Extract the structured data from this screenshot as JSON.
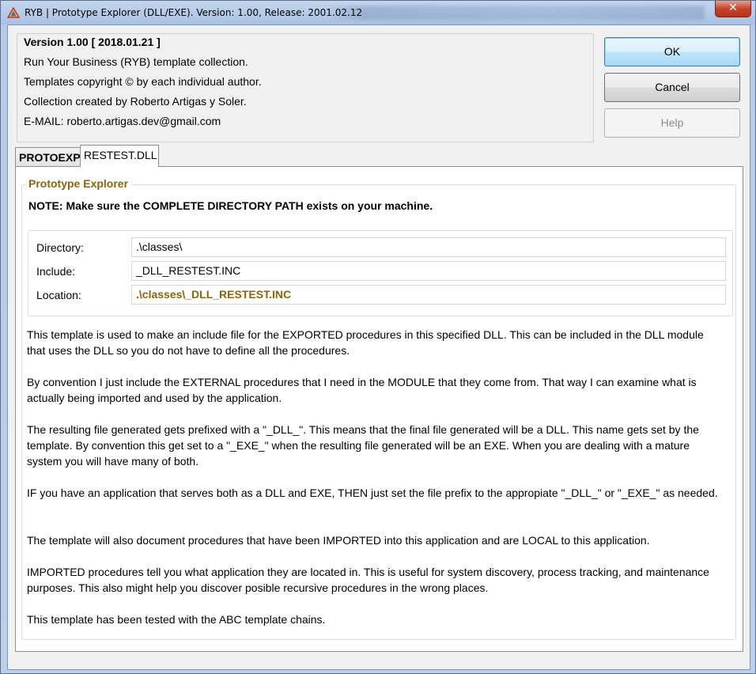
{
  "window": {
    "title": "RYB | Prototype Explorer (DLL/EXE). Version: 1.00, Release: 2001.02.12",
    "close_glyph": "✕"
  },
  "info": {
    "version": "Version 1.00 [ 2018.01.21 ]",
    "line1": "Run Your Business (RYB) template collection.",
    "line2": "Templates copyright © by each individual author.",
    "line3": "Collection created by Roberto Artigas y Soler.",
    "line4": "E-MAIL: roberto.artigas.dev@gmail.com"
  },
  "buttons": {
    "ok": "OK",
    "cancel": "Cancel",
    "help": "Help"
  },
  "tabs": [
    {
      "label": "PROTOEXP",
      "active": false
    },
    {
      "label": "RESTEST.DLL",
      "active": true
    }
  ],
  "panel": {
    "group_title": "Prototype Explorer",
    "note": "NOTE: Make sure the COMPLETE DIRECTORY PATH exists on your machine.",
    "fields": {
      "directory_label": "Directory:",
      "directory_value": ".\\classes\\",
      "include_label": "Include:",
      "include_value": "_DLL_RESTEST.INC",
      "location_label": "Location:",
      "location_value": ".\\classes\\_DLL_RESTEST.INC"
    },
    "paragraphs": [
      "This template is used to make an include file for the EXPORTED procedures in this specified DLL. This can be included in the DLL module that uses the DLL so you do not have to define all the procedures.",
      "By convention I just include the EXTERNAL procedures that I need in the MODULE that they come from. That way I can examine what is actually being imported and used by the application.",
      "The resulting file generated gets prefixed with a \"_DLL_\". This means that the final file generated will be a DLL. This name gets set by the template. By convention this get set to a \"_EXE_\" when the resulting file generated will be an EXE. When you are dealing with a mature system you will have many of both.",
      "IF you have an application that serves both as a DLL and EXE, THEN just set the file prefix to the appropiate \"_DLL_\" or \"_EXE_\" as needed.",
      "The template will also document procedures that have been IMPORTED into this application and are LOCAL to this application.",
      "IMPORTED procedures tell you what application they are located in. This is useful for system discovery, process tracking, and maintenance purposes. This also might help you discover posible recursive procedures in the wrong places.",
      "This template has been tested with the ABC template chains."
    ]
  },
  "colors": {
    "accent_gold": "#8b6508",
    "default_button": "#bee6fd"
  }
}
